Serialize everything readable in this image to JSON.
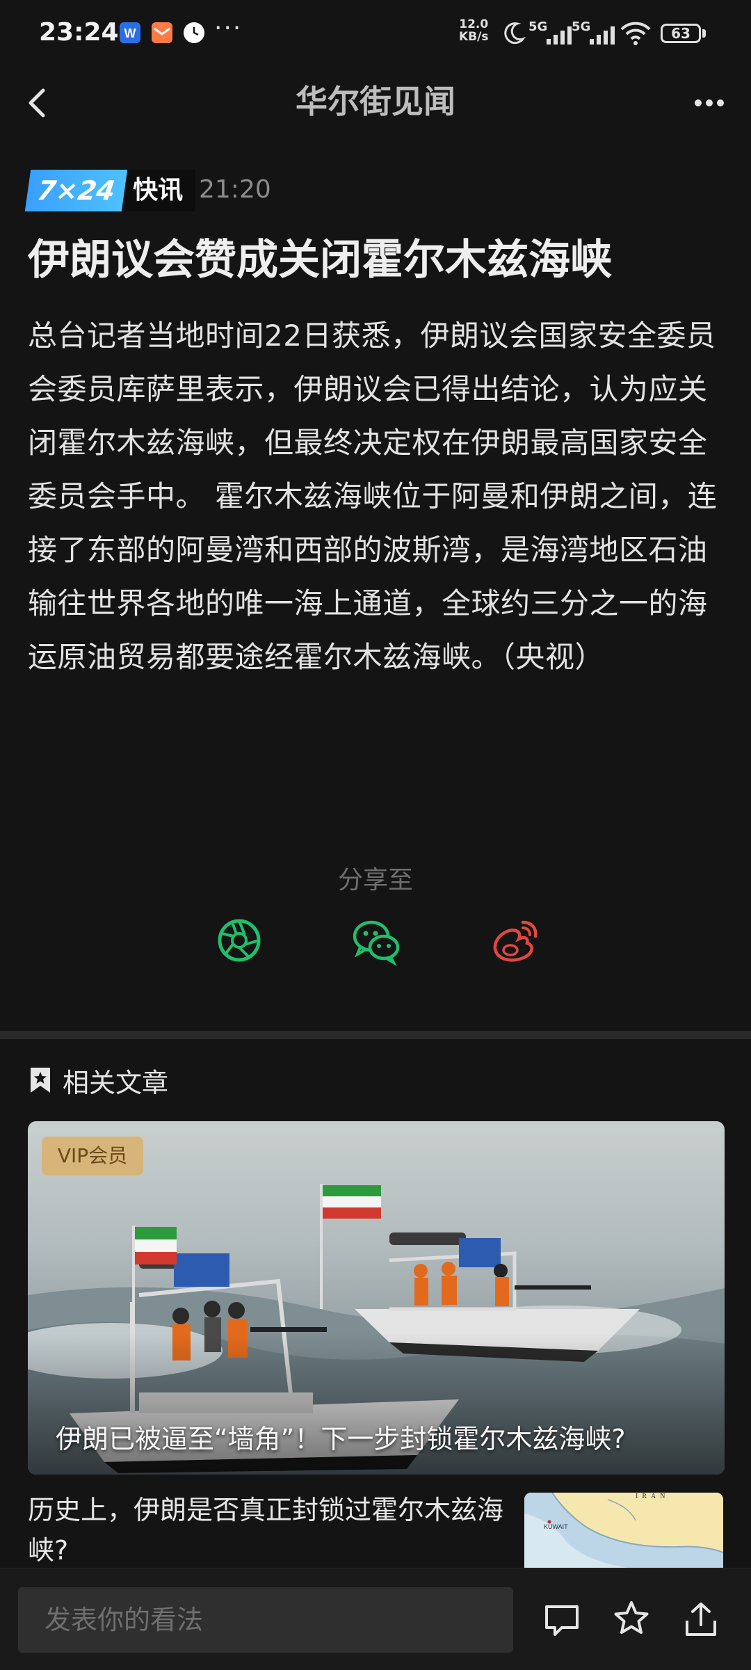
{
  "status_bar": {
    "time": "23:24",
    "more_dots": "···",
    "net_speed_value": "12.0",
    "net_speed_unit": "KB/s",
    "signal1": "5G",
    "signal2": "5G",
    "battery": "63",
    "icons": [
      "app-notification-icon-blue",
      "mail-icon",
      "clock-icon",
      "moon-icon",
      "signal-icon",
      "wifi-icon",
      "battery-icon"
    ]
  },
  "header": {
    "title": "华尔街见闻",
    "back_icon": "chevron-left-icon",
    "more_icon": "more-dots-icon"
  },
  "article": {
    "badge_724": "7×24",
    "badge_label": "快讯",
    "time": "21:20",
    "headline": "伊朗议会赞成关闭霍尔木兹海峡",
    "body": "总台记者当地时间22日获悉，伊朗议会国家安全委员会委员库萨里表示，伊朗议会已得出结论，认为应关闭霍尔木兹海峡，但最终决定权在伊朗最高国家安全委员会手中。 霍尔木兹海峡位于阿曼和伊朗之间，连接了东部的阿曼湾和西部的波斯湾，是海湾地区石油输往世界各地的唯一海上通道，全球约三分之一的海运原油贸易都要途经霍尔木兹海峡。（央视）"
  },
  "share": {
    "label": "分享至",
    "targets": [
      "moments-icon",
      "wechat-icon",
      "weibo-icon"
    ],
    "colors": {
      "moments": "#1fbf6b",
      "wechat": "#1fbf6b",
      "weibo": "#e0483e"
    }
  },
  "related": {
    "title": "相关文章",
    "items": [
      {
        "badge": "VIP会员",
        "caption": "伊朗已被逼至“墙角”！下一步封锁霍尔木兹海峡?"
      },
      {
        "title": "历史上，伊朗是否真正封锁过霍尔木兹海峡?",
        "map_labels": [
          "IRAN",
          "KUWAIT"
        ]
      }
    ]
  },
  "bottom_bar": {
    "comment_placeholder": "发表你的看法",
    "icons": [
      "comment-icon",
      "star-icon",
      "share-icon"
    ]
  }
}
